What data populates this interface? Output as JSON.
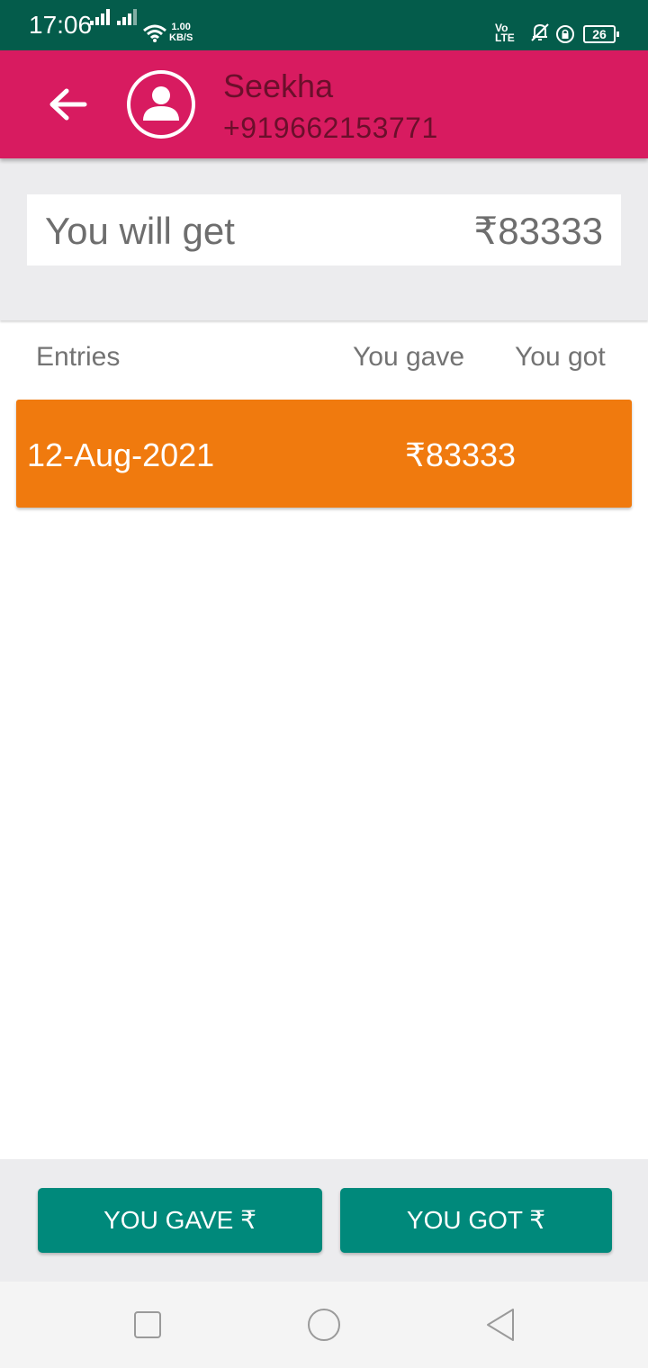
{
  "status_bar": {
    "time": "17:06",
    "net_speed_value": "1.00",
    "net_speed_unit": "KB/S",
    "volte_top": "Vo",
    "volte_bottom": "LTE",
    "battery": "26",
    "background": "#045c4b"
  },
  "header": {
    "contact_name": "Seekha",
    "contact_phone": "+919662153771",
    "background": "#d81b60"
  },
  "summary": {
    "label": "You will get",
    "amount": "₹83333"
  },
  "columns": {
    "entries": "Entries",
    "you_gave": "You gave",
    "you_got": "You got"
  },
  "entries": [
    {
      "date": "12-Aug-2021",
      "you_gave": "₹83333",
      "you_got": "",
      "color": "#f07a0e"
    }
  ],
  "actions": {
    "you_gave": "YOU GAVE ₹",
    "you_got": "YOU GOT ₹",
    "color": "#00897b"
  },
  "nav": {
    "recents_icon": "square-icon",
    "home_icon": "circle-icon",
    "back_icon": "triangle-back-icon"
  }
}
